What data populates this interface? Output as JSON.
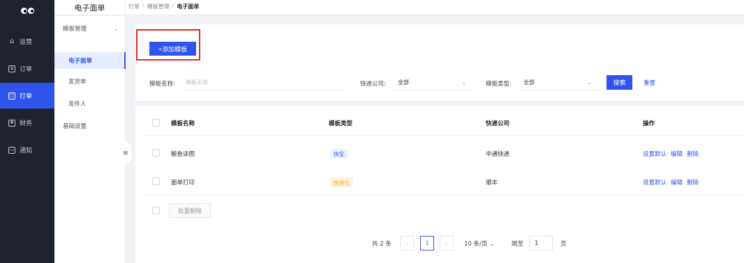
{
  "topbar": {
    "title": "电子面单"
  },
  "breadcrumb": [
    "打单",
    "模板管理",
    "电子面单"
  ],
  "nav": {
    "items": [
      {
        "label": "运营",
        "icon": "home-icon"
      },
      {
        "label": "订单",
        "icon": "order-icon"
      },
      {
        "label": "打单",
        "icon": "print-icon",
        "active": true
      },
      {
        "label": "财务",
        "icon": "finance-icon"
      },
      {
        "label": "通知",
        "icon": "notice-icon"
      }
    ]
  },
  "subnav": {
    "group": "模板管理",
    "items": [
      "电子面单",
      "发货单",
      "发件人"
    ],
    "basic": "基础设置"
  },
  "toolbar": {
    "add_label": "+添加模板"
  },
  "filters": {
    "name_label": "模板名称:",
    "name_placeholder": "模板名称",
    "company_label": "快递公司:",
    "company_value": "全部",
    "type_label": "模板类型:",
    "type_value": "全部",
    "search_label": "搜索",
    "reset_label": "重置"
  },
  "table": {
    "headers": [
      "模板名称",
      "模板类型",
      "快递公司",
      "操作"
    ],
    "rows": [
      {
        "name": "鲸鱼读图",
        "type": "快宝",
        "company": "中通快递",
        "ops": [
          "设置默认",
          "编辑",
          "删除"
        ]
      },
      {
        "name": "面单打印",
        "type": "快递鸟",
        "company": "顺丰",
        "ops": [
          "设置默认",
          "编辑",
          "删除"
        ]
      }
    ],
    "batch_delete": "批量删除"
  },
  "pagination": {
    "total": "共 2 条",
    "current": "1",
    "page_size": "10 条/页",
    "jump_label": "跳至",
    "jump_value": "1",
    "page_suffix": "页"
  },
  "colors": {
    "primary": "#2f54eb",
    "nav_bg": "#1f2330",
    "highlight": "#e5271c"
  }
}
